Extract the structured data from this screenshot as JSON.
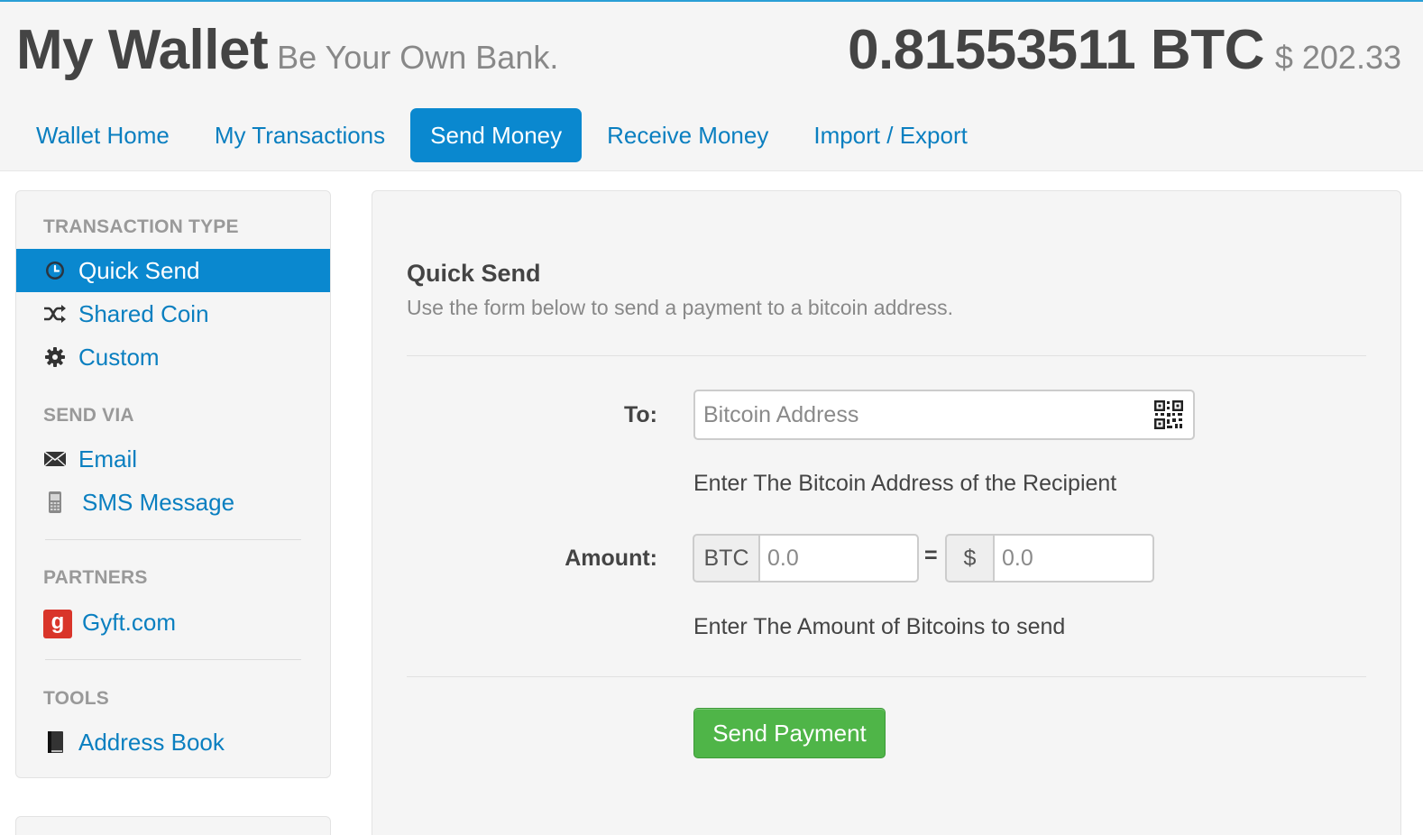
{
  "header": {
    "title": "My Wallet",
    "tagline": "Be Your Own Bank.",
    "balance_btc": "0.81553511 BTC",
    "balance_usd": "$ 202.33"
  },
  "nav": {
    "tabs": [
      {
        "label": "Wallet Home",
        "active": false
      },
      {
        "label": "My Transactions",
        "active": false
      },
      {
        "label": "Send Money",
        "active": true
      },
      {
        "label": "Receive Money",
        "active": false
      },
      {
        "label": "Import / Export",
        "active": false
      }
    ]
  },
  "sidebar": {
    "transaction_type_heading": "TRANSACTION TYPE",
    "transaction_types": [
      {
        "label": "Quick Send",
        "icon": "clock-icon",
        "active": true
      },
      {
        "label": "Shared Coin",
        "icon": "shuffle-icon",
        "active": false
      },
      {
        "label": "Custom",
        "icon": "gear-icon",
        "active": false
      }
    ],
    "send_via_heading": "SEND VIA",
    "send_via": [
      {
        "label": "Email",
        "icon": "envelope-icon"
      },
      {
        "label": "SMS Message",
        "icon": "phone-icon"
      }
    ],
    "partners_heading": "PARTNERS",
    "partners": [
      {
        "label": "Gyft.com",
        "icon": "gyft-logo-icon",
        "logo_letter": "g"
      }
    ],
    "tools_heading": "TOOLS",
    "tools": [
      {
        "label": "Address Book",
        "icon": "book-icon"
      }
    ]
  },
  "form": {
    "title": "Quick Send",
    "subtitle": "Use the form below to send a payment to a bitcoin address.",
    "to_label": "To:",
    "address_placeholder": "Bitcoin Address",
    "address_help": "Enter The Bitcoin Address of the Recipient",
    "amount_label": "Amount:",
    "btc_addon": "BTC",
    "btc_placeholder": "0.0",
    "equals": "=",
    "usd_addon": "$",
    "usd_placeholder": "0.0",
    "amount_help": "Enter The Amount of Bitcoins to send",
    "send_button_label": "Send Payment"
  },
  "colors": {
    "accent": "#0a88cf",
    "link": "#0a7fc0",
    "send_button": "#4fb548",
    "gyft_red": "#d9352a"
  }
}
